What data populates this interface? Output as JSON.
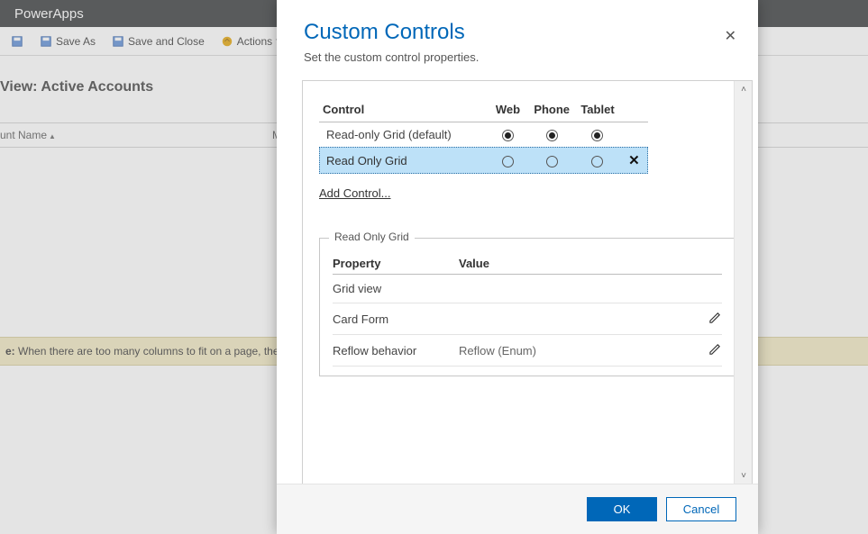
{
  "app": {
    "title": "PowerApps"
  },
  "toolbar": {
    "save_as": "Save As",
    "save_close": "Save and Close",
    "actions": "Actions"
  },
  "view": {
    "title_prefix": "View:",
    "title_name": "Active Accounts",
    "col_name": "unt Name",
    "col_main": "Main"
  },
  "note": {
    "label": "e:",
    "text": "When there are too many columns to fit on a page, the view "
  },
  "modal": {
    "title": "Custom Controls",
    "subtitle": "Set the custom control properties.",
    "close": "✕"
  },
  "controls_table": {
    "head_control": "Control",
    "head_web": "Web",
    "head_phone": "Phone",
    "head_tablet": "Tablet",
    "row_default": "Read-only Grid (default)",
    "row_selected": "Read Only Grid",
    "delete_glyph": "✕",
    "add_control": "Add Control..."
  },
  "fieldset": {
    "legend": "Read Only Grid",
    "head_property": "Property",
    "head_value": "Value",
    "row1_prop": "Grid view",
    "row1_val": "",
    "row2_prop": "Card Form",
    "row2_val": "",
    "row3_prop": "Reflow behavior",
    "row3_val": "Reflow (Enum)"
  },
  "buttons": {
    "ok": "OK",
    "cancel": "Cancel"
  }
}
